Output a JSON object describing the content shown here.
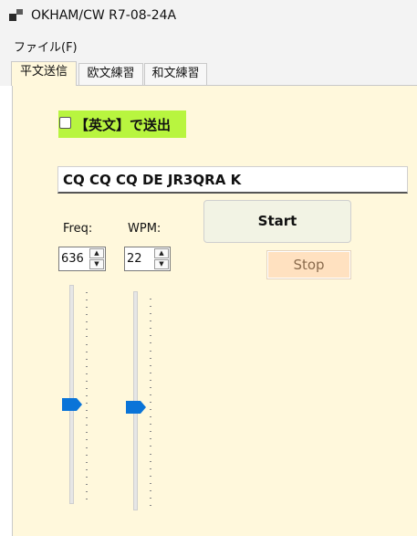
{
  "window": {
    "title": "OKHAM/CW R7-08-24A"
  },
  "menu": {
    "file": "ファイル(F)"
  },
  "tabs": [
    {
      "label": "平文送信",
      "active": true
    },
    {
      "label": "欧文練習",
      "active": false
    },
    {
      "label": "和文練習",
      "active": false
    }
  ],
  "english_mode": {
    "label": "【英文】で送出",
    "checked": false
  },
  "message": {
    "value": "CQ CQ CQ DE JR3QRA K"
  },
  "freq": {
    "label": "Freq:",
    "value": "636"
  },
  "wpm": {
    "label": "WPM:",
    "value": "22"
  },
  "buttons": {
    "start": "Start",
    "stop": "Stop"
  },
  "sliders": {
    "freq_level": 0.55,
    "wpm_level": 0.53
  },
  "colors": {
    "panel_bg": "#fff8dc",
    "checkbox_highlight": "#b8f53f",
    "stop_bg": "#ffe1c0",
    "slider_thumb": "#0a74d8"
  }
}
